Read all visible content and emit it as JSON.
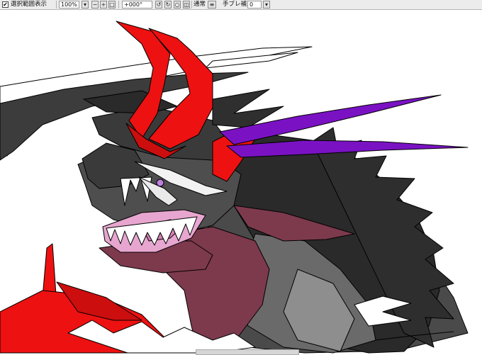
{
  "toolbar": {
    "selection_display_label": "選択範囲表示",
    "selection_display_checked": true,
    "zoom_value": "100%",
    "rotation_value": "+000°",
    "blend_mode": "通常",
    "stabilizer_label": "手ブレ補正",
    "stabilizer_value": "0"
  },
  "icons": [
    "checkbox-checked-icon",
    "dropdown-arrow-icon",
    "zoom-out-icon",
    "zoom-in-icon",
    "zoom-fit-icon",
    "rotate-left-icon",
    "rotate-right-icon",
    "rotate-reset-icon",
    "flip-icon",
    "layer-list-icon",
    "chevron-down-icon"
  ],
  "artwork": {
    "subject": "dragon",
    "colors": {
      "red": "#ee1111",
      "purple": "#7a12c4",
      "dark_gray": "#3a3a3a",
      "mid_gray": "#5f5f5f",
      "light_gray": "#8e8e8e",
      "pink": "#e7a6cf",
      "maroon": "#7d3a4d",
      "outline": "#000000"
    }
  }
}
